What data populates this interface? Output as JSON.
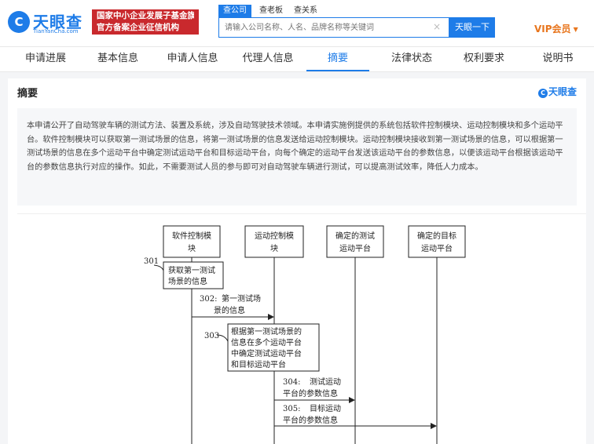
{
  "header": {
    "logo_text": "天眼查",
    "logo_sub": "TianYanCha.com",
    "badge_line1": "国家中小企业发展子基金旗下",
    "badge_line2": "官方备案企业征信机构",
    "search_tabs": [
      "查公司",
      "查老板",
      "查关系"
    ],
    "search_placeholder": "请输入公司名称、人名、品牌名称等关键词",
    "search_button": "天眼一下",
    "vip_label": "VIP会员"
  },
  "nav": {
    "items": [
      "申请进展",
      "基本信息",
      "申请人信息",
      "代理人信息",
      "摘要",
      "法律状态",
      "权利要求",
      "说明书"
    ],
    "active_index": 4
  },
  "section": {
    "title": "摘要",
    "watermark": "天眼查",
    "abstract": "本申请公开了自动驾驶车辆的测试方法、装置及系统，涉及自动驾驶技术领域。本申请实施例提供的系统包括软件控制模块、运动控制模块和多个运动平台。软件控制模块可以获取第一测试场景的信息，将第一测试场景的信息发送给运动控制模块。运动控制模块接收到第一测试场景的信息，可以根据第一测试场景的信息在多个运动平台中确定测试运动平台和目标运动平台，向每个确定的运动平台发送该运动平台的参数信息，以便该运动平台根据该运动平台的参数信息执行对应的操作。如此，不需要测试人员的参与即可对自动驾驶车辆进行测试，可以提高测试效率，降低人力成本。"
  },
  "diagram": {
    "lanes": [
      [
        "软件控制模",
        "块"
      ],
      [
        "运动控制模",
        "块"
      ],
      [
        "确定的测试",
        "运动平台"
      ],
      [
        "确定的目标",
        "运动平台"
      ]
    ],
    "steps": [
      {
        "num": "301",
        "lines": [
          "获取第一测试",
          "场景的信息"
        ]
      },
      {
        "num": "302:",
        "lines": [
          "第一测试场",
          "景的信息"
        ]
      },
      {
        "num": "303",
        "lines": [
          "根据第一测试场景的",
          "信息在多个运动平台",
          "中确定测试运动平台",
          "和目标运动平台"
        ]
      },
      {
        "num": "304:",
        "lines": [
          "测试运动",
          "平台的参数信息"
        ]
      },
      {
        "num": "305:",
        "lines": [
          "目标运动",
          "平台的参数信息"
        ]
      }
    ]
  }
}
